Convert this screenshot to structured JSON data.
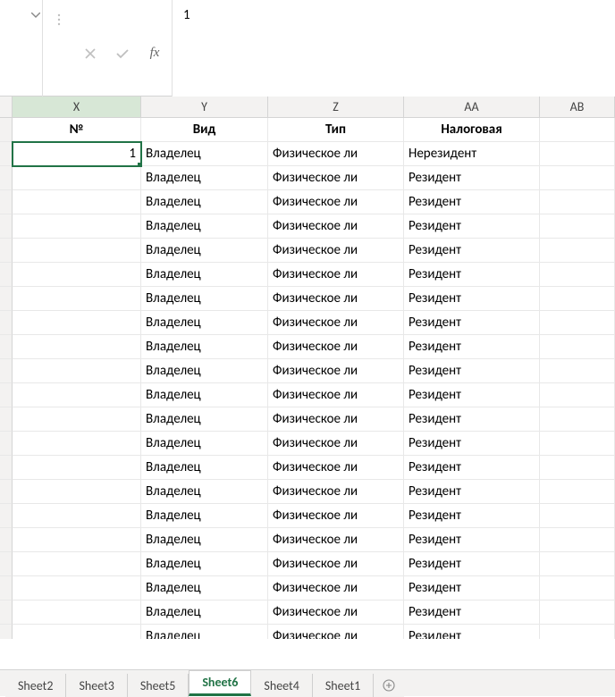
{
  "formulaBar": {
    "value": "1",
    "fxLabel": "fx"
  },
  "columns": [
    "X",
    "Y",
    "Z",
    "AA",
    "AB"
  ],
  "activeColumn": "X",
  "headerRow": {
    "x": "№",
    "y": "Вид",
    "z": "Тип",
    "aa": "Налоговая",
    "ab": ""
  },
  "selectedCell": {
    "col": "X",
    "rowIndex": 0
  },
  "dataRows": [
    {
      "x": "1",
      "y": "Владелец",
      "z": "Физическое ли",
      "aa": "Нерезидент"
    },
    {
      "x": "",
      "y": "Владелец",
      "z": "Физическое ли",
      "aa": "Резидент"
    },
    {
      "x": "",
      "y": "Владелец",
      "z": "Физическое ли",
      "aa": "Резидент"
    },
    {
      "x": "",
      "y": "Владелец",
      "z": "Физическое ли",
      "aa": "Резидент"
    },
    {
      "x": "",
      "y": "Владелец",
      "z": "Физическое ли",
      "aa": "Резидент"
    },
    {
      "x": "",
      "y": "Владелец",
      "z": "Физическое ли",
      "aa": "Резидент"
    },
    {
      "x": "",
      "y": "Владелец",
      "z": "Физическое ли",
      "aa": "Резидент"
    },
    {
      "x": "",
      "y": "Владелец",
      "z": "Физическое ли",
      "aa": "Резидент"
    },
    {
      "x": "",
      "y": "Владелец",
      "z": "Физическое ли",
      "aa": "Резидент"
    },
    {
      "x": "",
      "y": "Владелец",
      "z": "Физическое ли",
      "aa": "Резидент"
    },
    {
      "x": "",
      "y": "Владелец",
      "z": "Физическое ли",
      "aa": "Резидент"
    },
    {
      "x": "",
      "y": "Владелец",
      "z": "Физическое ли",
      "aa": "Резидент"
    },
    {
      "x": "",
      "y": "Владелец",
      "z": "Физическое ли",
      "aa": "Резидент"
    },
    {
      "x": "",
      "y": "Владелец",
      "z": "Физическое ли",
      "aa": "Резидент"
    },
    {
      "x": "",
      "y": "Владелец",
      "z": "Физическое ли",
      "aa": "Резидент"
    },
    {
      "x": "",
      "y": "Владелец",
      "z": "Физическое ли",
      "aa": "Резидент"
    },
    {
      "x": "",
      "y": "Владелец",
      "z": "Физическое ли",
      "aa": "Резидент"
    },
    {
      "x": "",
      "y": "Владелец",
      "z": "Физическое ли",
      "aa": "Резидент"
    },
    {
      "x": "",
      "y": "Владелец",
      "z": "Физическое ли",
      "aa": "Резидент"
    },
    {
      "x": "",
      "y": "Владелец",
      "z": "Физическое ли",
      "aa": "Резидент"
    },
    {
      "x": "",
      "y": "Владелец",
      "z": "Физическое ли",
      "aa": "Резидент"
    }
  ],
  "sheetTabs": [
    {
      "name": "Sheet2",
      "active": false
    },
    {
      "name": "Sheet3",
      "active": false
    },
    {
      "name": "Sheet5",
      "active": false
    },
    {
      "name": "Sheet6",
      "active": true
    },
    {
      "name": "Sheet4",
      "active": false
    },
    {
      "name": "Sheet1",
      "active": false
    }
  ]
}
